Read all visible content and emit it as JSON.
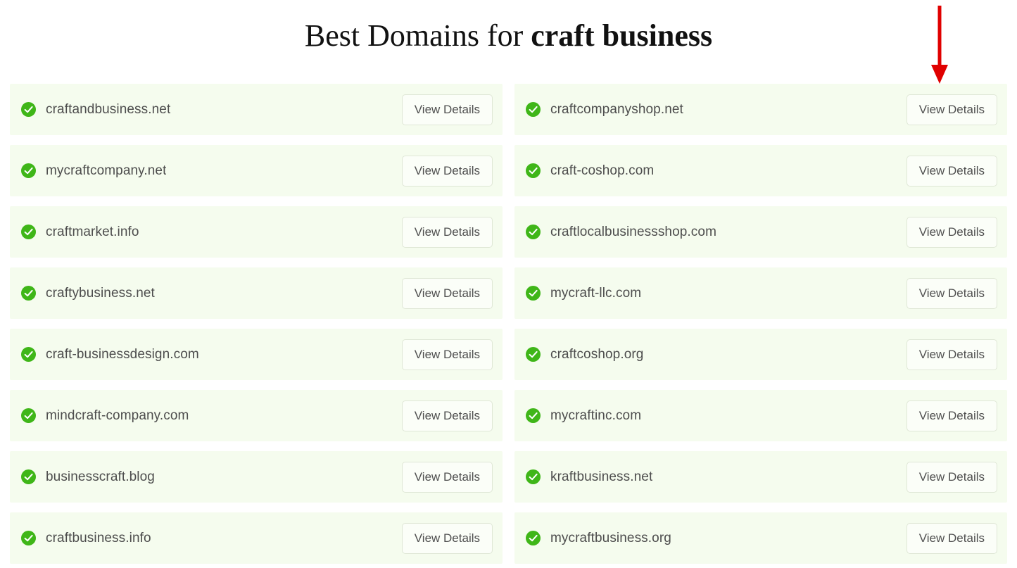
{
  "header": {
    "title_prefix": "Best Domains for ",
    "keyword": "craft business"
  },
  "buttons": {
    "view_details_label": "View Details"
  },
  "icons": {
    "check_circle": "check-circle-icon",
    "annotation_arrow": "red-down-arrow-icon"
  },
  "colors": {
    "row_background": "#f5fcee",
    "check_icon_green": "#3fb618",
    "button_border": "#dfe7d6",
    "button_background": "#fbfef8",
    "domain_text": "#4d4d4d",
    "title_text": "#111111",
    "arrow_red": "#e00000"
  },
  "results": {
    "left_column": [
      {
        "domain": "craftandbusiness.net"
      },
      {
        "domain": "mycraftcompany.net"
      },
      {
        "domain": "craftmarket.info"
      },
      {
        "domain": "craftybusiness.net"
      },
      {
        "domain": "craft-businessdesign.com"
      },
      {
        "domain": "mindcraft-company.com"
      },
      {
        "domain": "businesscraft.blog"
      },
      {
        "domain": "craftbusiness.info"
      }
    ],
    "right_column": [
      {
        "domain": "craftcompanyshop.net"
      },
      {
        "domain": "craft-coshop.com"
      },
      {
        "domain": "craftlocalbusinessshop.com"
      },
      {
        "domain": "mycraft-llc.com"
      },
      {
        "domain": "craftcoshop.org"
      },
      {
        "domain": "mycraftinc.com"
      },
      {
        "domain": "kraftbusiness.net"
      },
      {
        "domain": "mycraftbusiness.org"
      }
    ]
  }
}
